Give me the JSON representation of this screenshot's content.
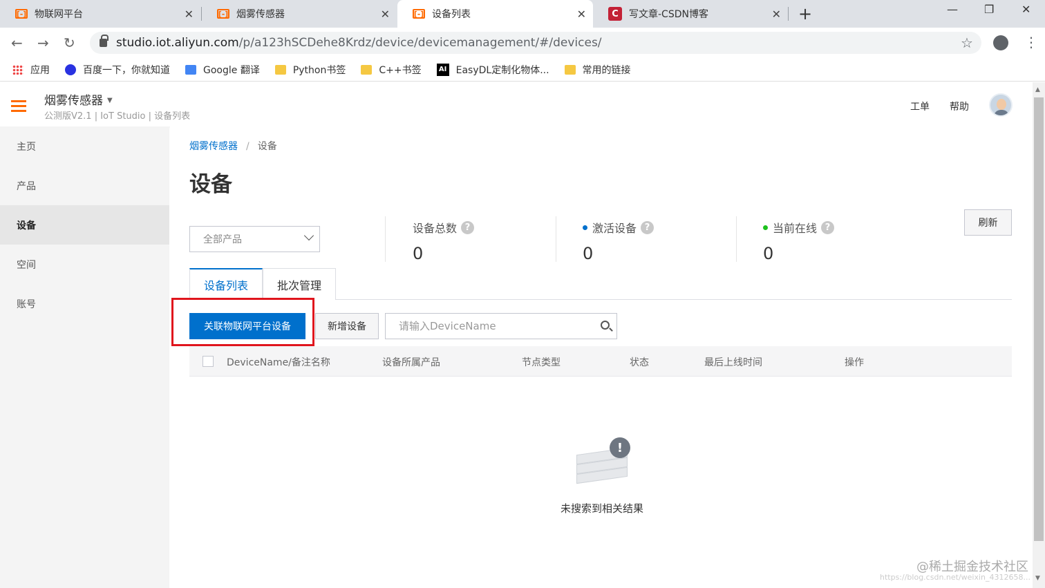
{
  "browser": {
    "tabs": [
      {
        "title": "物联网平台",
        "favicon": "aliyun-icon",
        "active": false
      },
      {
        "title": "烟雾传感器",
        "favicon": "aliyun-icon",
        "active": false
      },
      {
        "title": "设备列表",
        "favicon": "aliyun-icon",
        "active": true
      },
      {
        "title": "写文章-CSDN博客",
        "favicon": "csdn-icon",
        "active": false
      }
    ],
    "favicon_glyph": "[-]",
    "csdn_glyph": "C",
    "url_host": "studio.iot.aliyun.com",
    "url_path": "/p/a123hSCDehe8Krdz/device/devicemanagement/#/devices/",
    "bookmarks": [
      {
        "label": "应用",
        "icon": "apps-icon"
      },
      {
        "label": "百度一下，你就知道",
        "icon": "baidu-icon"
      },
      {
        "label": "Google 翻译",
        "icon": "google-translate-icon"
      },
      {
        "label": "Python书签",
        "icon": "folder-icon"
      },
      {
        "label": "C++书签",
        "icon": "folder-icon"
      },
      {
        "label": "EasyDL定制化物体...",
        "icon": "ai-icon"
      },
      {
        "label": "常用的链接",
        "icon": "folder-icon"
      }
    ],
    "ai_glyph": "AI"
  },
  "header": {
    "project_name": "烟雾传感器",
    "project_sub": "公测版V2.1 | IoT Studio | 设备列表",
    "links": [
      "工单",
      "帮助"
    ]
  },
  "sidebar": {
    "items": [
      {
        "label": "主页",
        "active": false
      },
      {
        "label": "产品",
        "active": false
      },
      {
        "label": "设备",
        "active": true
      },
      {
        "label": "空间",
        "active": false
      },
      {
        "label": "账号",
        "active": false
      }
    ]
  },
  "main": {
    "breadcrumb": {
      "link": "烟雾传感器",
      "separator": "/",
      "current": "设备"
    },
    "title": "设备",
    "product_select": "全部产品",
    "stats": [
      {
        "label": "设备总数",
        "value": "0",
        "dot": null
      },
      {
        "label": "激活设备",
        "value": "0",
        "dot": "#0070cc"
      },
      {
        "label": "当前在线",
        "value": "0",
        "dot": "#1dc11d"
      }
    ],
    "refresh_label": "刷新",
    "tabs": [
      "设备列表",
      "批次管理"
    ],
    "primary_button": "关联物联网平台设备",
    "add_button": "新增设备",
    "search_placeholder": "请输入DeviceName",
    "table_columns": [
      "DeviceName/备注名称",
      "设备所属产品",
      "节点类型",
      "状态",
      "最后上线时间",
      "操作"
    ],
    "empty_text": "未搜索到相关结果",
    "help_glyph": "?",
    "empty_glyph": "!"
  },
  "watermark": {
    "text": "@稀土掘金技术社区",
    "url": "https://blog.csdn.net/weixin_4312658..."
  },
  "colors": {
    "accent": "#0070cc",
    "brand_orange": "#ff6a00",
    "highlight_red": "#e0151d"
  }
}
